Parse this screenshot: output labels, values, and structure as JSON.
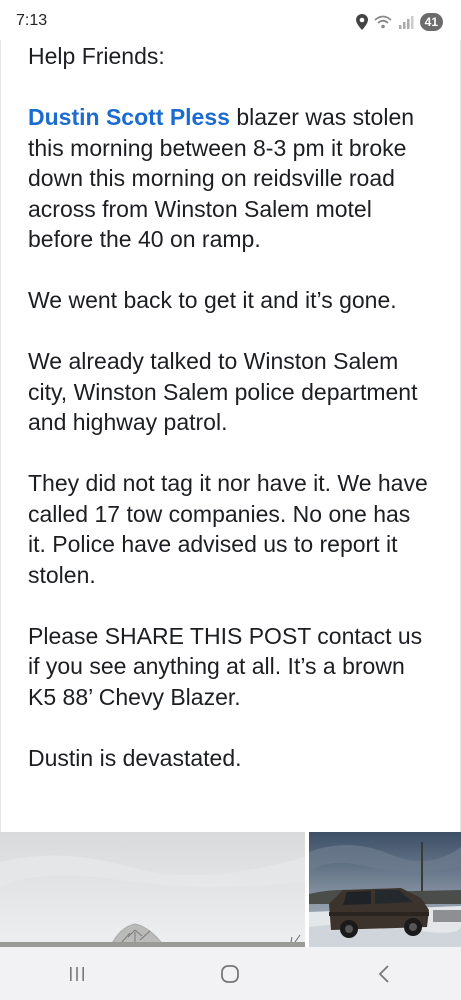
{
  "status_bar": {
    "time": "7:13",
    "battery": "41",
    "icons": [
      "location-icon",
      "wifi-icon",
      "signal-icon",
      "battery-icon"
    ]
  },
  "post": {
    "greeting": "Help Friends:",
    "mention": "Dustin Scott Pless",
    "paragraph1_rest": " blazer was stolen this morning between 8-3 pm it broke down this morning on reidsville road across from Winston Salem motel before the 40 on ramp.",
    "paragraph2": "We went back to get it and it’s gone.",
    "paragraph3": "We already talked to Winston Salem city, Winston Salem police department and highway patrol.",
    "paragraph4": "They did not tag it nor have it. We have called 17 tow companies. No one has it. Police have advised us to report it stolen.",
    "paragraph5": "Please SHARE THIS POST  contact us if you see anything at all.  It’s a brown K5 88’ Chevy Blazer.",
    "paragraph6": "Dustin is devastated."
  },
  "photos": [
    "photo-overcast-sky-trees",
    "photo-chevy-blazer-snow"
  ],
  "nav_bar": {
    "buttons": [
      "recents-icon",
      "home-icon",
      "back-icon"
    ]
  },
  "colors": {
    "mention": "#1c6ccf",
    "text": "#1c1e21",
    "nav_background": "#f2f2f4",
    "battery_pill": "#6b6b6b"
  }
}
